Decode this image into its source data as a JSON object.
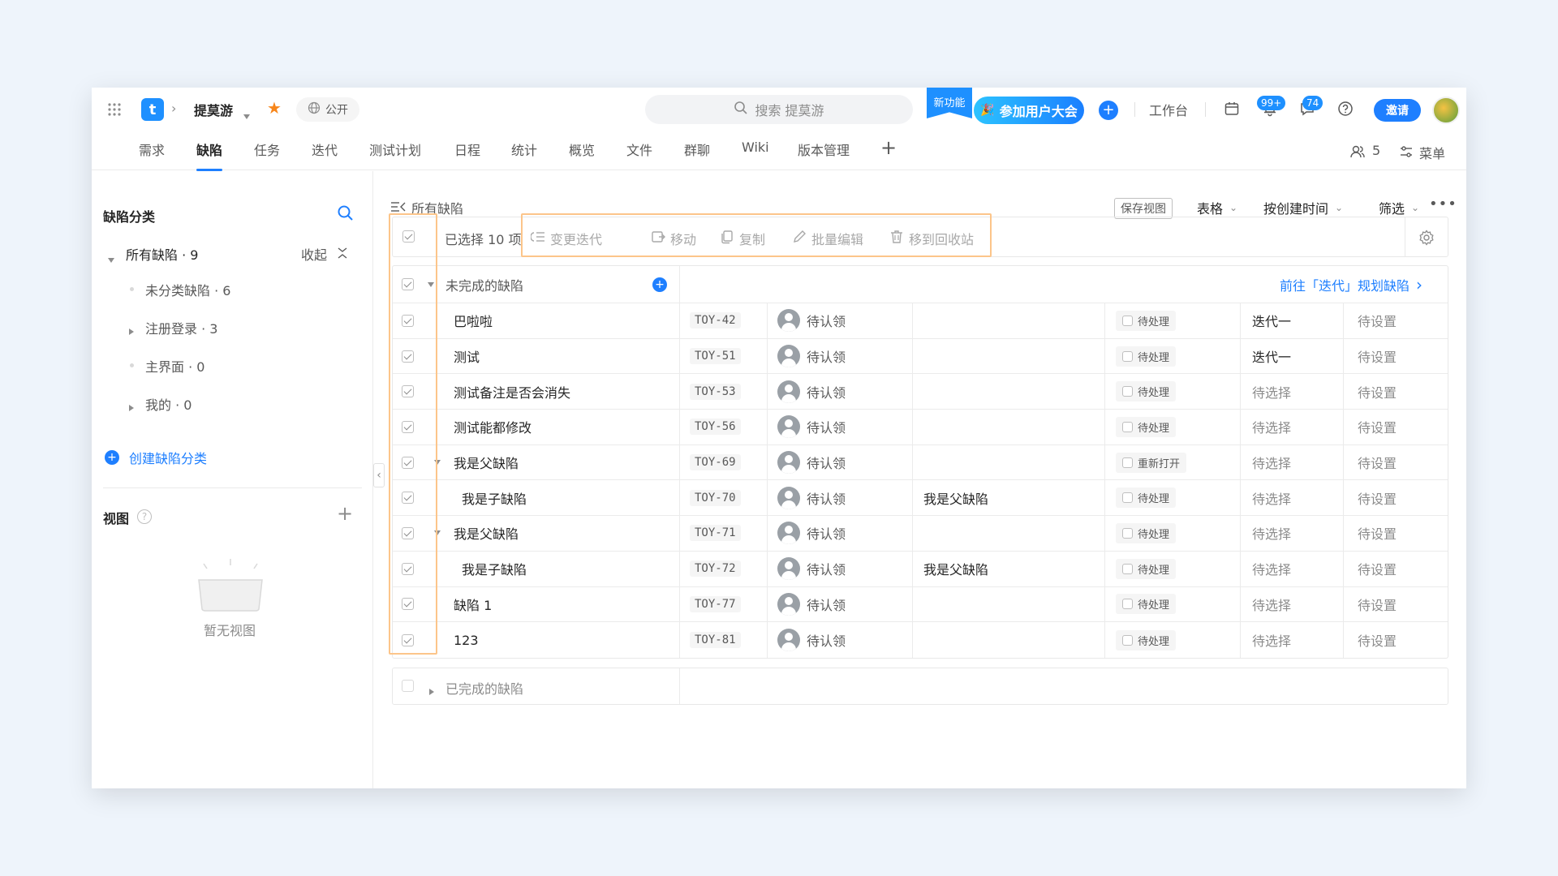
{
  "header": {
    "project_name": "提莫游",
    "visibility": "公开",
    "search_placeholder": "搜索 提莫游",
    "new_feature_ribbon": "新功能",
    "event_button": "参加用户大会",
    "workbench": "工作台",
    "notifications_badge": "99+",
    "messages_badge": "74",
    "invite_button": "邀请",
    "logo_letter": "t"
  },
  "tabs": [
    "需求",
    "缺陷",
    "任务",
    "迭代",
    "测试计划",
    "日程",
    "统计",
    "概览",
    "文件",
    "群聊",
    "Wiki",
    "版本管理"
  ],
  "tabs_right": {
    "members_count": "5",
    "menu_label": "菜单"
  },
  "sidebar": {
    "title": "缺陷分类",
    "all_defects": "所有缺陷 · 9",
    "collapse": "收起",
    "categories": [
      {
        "label": "未分类缺陷 · 6",
        "type": "dot"
      },
      {
        "label": "注册登录 · 3",
        "type": "arrow"
      },
      {
        "label": "主界面 · 0",
        "type": "dot"
      },
      {
        "label": "我的 · 0",
        "type": "arrow"
      }
    ],
    "create_category": "创建缺陷分类",
    "views_title": "视图",
    "empty_views": "暂无视图"
  },
  "main": {
    "breadcrumb": "所有缺陷",
    "save_view": "保存视图",
    "view_mode": "表格",
    "sort": "按创建时间",
    "filter": "筛选"
  },
  "toolbar": {
    "selected": "已选择 10 项",
    "actions": [
      "变更迭代",
      "移动",
      "复制",
      "批量编辑",
      "移到回收站"
    ]
  },
  "table": {
    "group_title": "未完成的缺陷",
    "plan_link": "前往「迭代」规划缺陷",
    "completed_group": "已完成的缺陷",
    "rows": [
      {
        "title": "巴啦啦",
        "id": "TOY-42",
        "assignee": "待认领",
        "parent": "",
        "status": "待处理",
        "iteration": "迭代一",
        "priority": "待设置",
        "indent": 0,
        "expandable": false,
        "dark_iter": true
      },
      {
        "title": "测试",
        "id": "TOY-51",
        "assignee": "待认领",
        "parent": "",
        "status": "待处理",
        "iteration": "迭代一",
        "priority": "待设置",
        "indent": 0,
        "expandable": false,
        "dark_iter": true
      },
      {
        "title": "测试备注是否会消失",
        "id": "TOY-53",
        "assignee": "待认领",
        "parent": "",
        "status": "待处理",
        "iteration": "待选择",
        "priority": "待设置",
        "indent": 0,
        "expandable": false,
        "dark_iter": false
      },
      {
        "title": "测试能都修改",
        "id": "TOY-56",
        "assignee": "待认领",
        "parent": "",
        "status": "待处理",
        "iteration": "待选择",
        "priority": "待设置",
        "indent": 0,
        "expandable": false,
        "dark_iter": false
      },
      {
        "title": "我是父缺陷",
        "id": "TOY-69",
        "assignee": "待认领",
        "parent": "",
        "status": "重新打开",
        "iteration": "待选择",
        "priority": "待设置",
        "indent": 0,
        "expandable": true,
        "dark_iter": false
      },
      {
        "title": "我是子缺陷",
        "id": "TOY-70",
        "assignee": "待认领",
        "parent": "我是父缺陷",
        "status": "待处理",
        "iteration": "待选择",
        "priority": "待设置",
        "indent": 1,
        "expandable": false,
        "dark_iter": false
      },
      {
        "title": "我是父缺陷",
        "id": "TOY-71",
        "assignee": "待认领",
        "parent": "",
        "status": "待处理",
        "iteration": "待选择",
        "priority": "待设置",
        "indent": 0,
        "expandable": true,
        "dark_iter": false
      },
      {
        "title": "我是子缺陷",
        "id": "TOY-72",
        "assignee": "待认领",
        "parent": "我是父缺陷",
        "status": "待处理",
        "iteration": "待选择",
        "priority": "待设置",
        "indent": 1,
        "expandable": false,
        "dark_iter": false
      },
      {
        "title": "缺陷 1",
        "id": "TOY-77",
        "assignee": "待认领",
        "parent": "",
        "status": "待处理",
        "iteration": "待选择",
        "priority": "待设置",
        "indent": 0,
        "expandable": false,
        "dark_iter": false
      },
      {
        "title": "123",
        "id": "TOY-81",
        "assignee": "待认领",
        "parent": "",
        "status": "待处理",
        "iteration": "待选择",
        "priority": "待设置",
        "indent": 0,
        "expandable": false,
        "dark_iter": false
      }
    ]
  },
  "colors": {
    "accent": "#1e7fff",
    "highlight_box": "#fcc58a",
    "favorite_star": "#f7861b"
  }
}
